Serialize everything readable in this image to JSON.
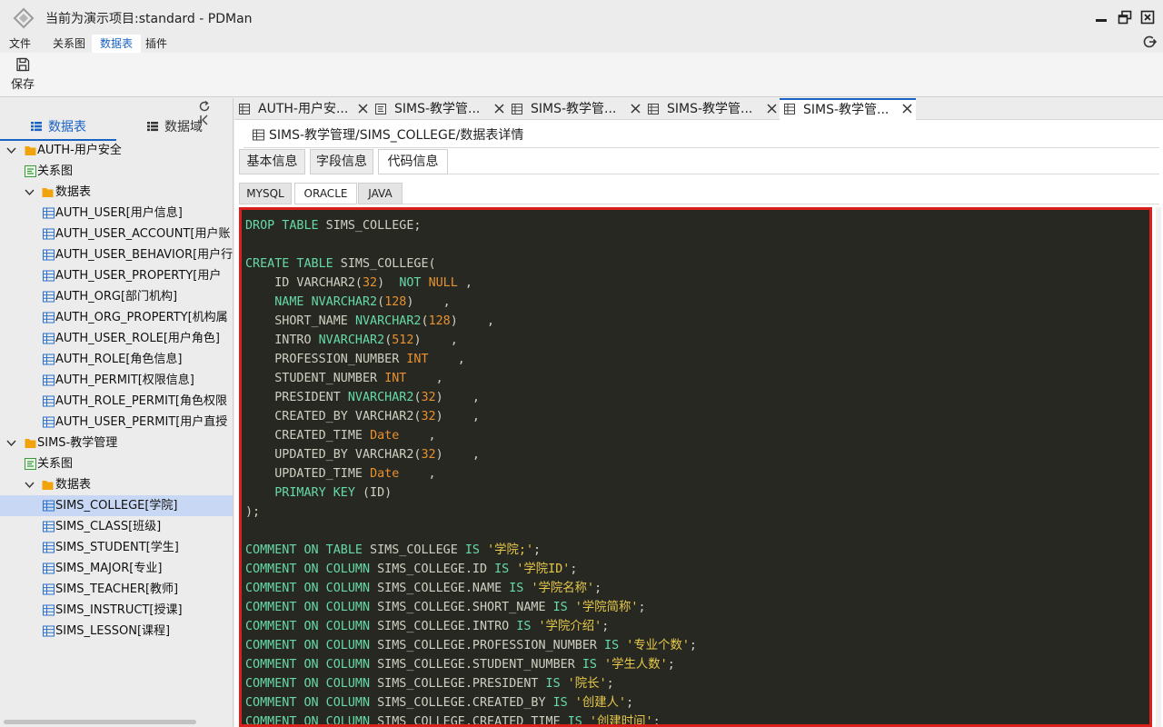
{
  "window": {
    "title": "当前为演示项目:standard - PDMan"
  },
  "menu": {
    "items": [
      {
        "label": "文件",
        "active": false
      },
      {
        "label": "关系图",
        "active": false
      },
      {
        "label": "数据表",
        "active": true
      },
      {
        "label": "插件",
        "active": false
      }
    ]
  },
  "toolbar": {
    "save_label": "保存"
  },
  "sidebar": {
    "tabs": [
      {
        "label": "数据表",
        "active": true
      },
      {
        "label": "数据域",
        "active": false
      }
    ],
    "tree": [
      {
        "kind": "module",
        "label": "AUTH-用户安全",
        "indent": 0,
        "expanded": true
      },
      {
        "kind": "diagram",
        "label": "关系图",
        "indent": 1
      },
      {
        "kind": "folder",
        "label": "数据表",
        "indent": 1,
        "expanded": true
      },
      {
        "kind": "table",
        "label": "AUTH_USER[用户信息]",
        "indent": 2
      },
      {
        "kind": "table",
        "label": "AUTH_USER_ACCOUNT[用户账",
        "indent": 2
      },
      {
        "kind": "table",
        "label": "AUTH_USER_BEHAVIOR[用户行",
        "indent": 2
      },
      {
        "kind": "table",
        "label": "AUTH_USER_PROPERTY[用户",
        "indent": 2
      },
      {
        "kind": "table",
        "label": "AUTH_ORG[部门机构]",
        "indent": 2
      },
      {
        "kind": "table",
        "label": "AUTH_ORG_PROPERTY[机构属",
        "indent": 2
      },
      {
        "kind": "table",
        "label": "AUTH_USER_ROLE[用户角色]",
        "indent": 2
      },
      {
        "kind": "table",
        "label": "AUTH_ROLE[角色信息]",
        "indent": 2
      },
      {
        "kind": "table",
        "label": "AUTH_PERMIT[权限信息]",
        "indent": 2
      },
      {
        "kind": "table",
        "label": "AUTH_ROLE_PERMIT[角色权限",
        "indent": 2
      },
      {
        "kind": "table",
        "label": "AUTH_USER_PERMIT[用户直授",
        "indent": 2
      },
      {
        "kind": "module",
        "label": "SIMS-教学管理",
        "indent": 0,
        "expanded": true
      },
      {
        "kind": "diagram",
        "label": "关系图",
        "indent": 1
      },
      {
        "kind": "folder",
        "label": "数据表",
        "indent": 1,
        "expanded": true
      },
      {
        "kind": "table",
        "label": "SIMS_COLLEGE[学院]",
        "indent": 2,
        "selected": true
      },
      {
        "kind": "table",
        "label": "SIMS_CLASS[班级]",
        "indent": 2
      },
      {
        "kind": "table",
        "label": "SIMS_STUDENT[学生]",
        "indent": 2
      },
      {
        "kind": "table",
        "label": "SIMS_MAJOR[专业]",
        "indent": 2
      },
      {
        "kind": "table",
        "label": "SIMS_TEACHER[教师]",
        "indent": 2
      },
      {
        "kind": "table",
        "label": "SIMS_INSTRUCT[授课]",
        "indent": 2
      },
      {
        "kind": "table",
        "label": "SIMS_LESSON[课程]",
        "indent": 2
      }
    ]
  },
  "doc_tabs": [
    {
      "icon": "table-icon",
      "label": "AUTH-用户安...",
      "active": false
    },
    {
      "icon": "diagram-icon",
      "label": "SIMS-教学管...",
      "active": false
    },
    {
      "icon": "table-icon",
      "label": "SIMS-教学管...",
      "active": false
    },
    {
      "icon": "table-icon",
      "label": "SIMS-教学管...",
      "active": false
    },
    {
      "icon": "table-icon",
      "label": "SIMS-教学管...",
      "active": true
    }
  ],
  "content": {
    "breadcrumb": "SIMS-教学管理/SIMS_COLLEGE/数据表详情",
    "sub_tabs": [
      {
        "label": "基本信息",
        "active": false
      },
      {
        "label": "字段信息",
        "active": false
      },
      {
        "label": "代码信息",
        "active": true
      }
    ],
    "db_tabs": [
      {
        "label": "MYSQL",
        "active": false
      },
      {
        "label": "ORACLE",
        "active": true
      },
      {
        "label": "JAVA",
        "active": false
      }
    ],
    "code_lines": [
      [
        [
          "kw",
          "DROP TABLE"
        ],
        [
          "tx",
          " SIMS_COLLEGE;"
        ]
      ],
      [],
      [
        [
          "kw",
          "CREATE TABLE"
        ],
        [
          "tx",
          " SIMS_COLLEGE("
        ]
      ],
      [
        [
          "tx",
          "    ID VARCHAR2("
        ],
        [
          "nm",
          "32"
        ],
        [
          "tx",
          ")  "
        ],
        [
          "kw",
          "NOT"
        ],
        [
          "tx",
          " "
        ],
        [
          "nm",
          "NULL"
        ],
        [
          "tx",
          " ,"
        ]
      ],
      [
        [
          "tx",
          "    "
        ],
        [
          "kw",
          "NAME"
        ],
        [
          "tx",
          " "
        ],
        [
          "ty",
          "NVARCHAR2"
        ],
        [
          "tx",
          "("
        ],
        [
          "nm",
          "128"
        ],
        [
          "tx",
          ")    ,"
        ]
      ],
      [
        [
          "tx",
          "    SHORT_NAME "
        ],
        [
          "ty",
          "NVARCHAR2"
        ],
        [
          "tx",
          "("
        ],
        [
          "nm",
          "128"
        ],
        [
          "tx",
          ")    ,"
        ]
      ],
      [
        [
          "tx",
          "    INTRO "
        ],
        [
          "ty",
          "NVARCHAR2"
        ],
        [
          "tx",
          "("
        ],
        [
          "nm",
          "512"
        ],
        [
          "tx",
          ")    ,"
        ]
      ],
      [
        [
          "tx",
          "    PROFESSION_NUMBER "
        ],
        [
          "nm",
          "INT"
        ],
        [
          "tx",
          "    ,"
        ]
      ],
      [
        [
          "tx",
          "    STUDENT_NUMBER "
        ],
        [
          "nm",
          "INT"
        ],
        [
          "tx",
          "    ,"
        ]
      ],
      [
        [
          "tx",
          "    PRESIDENT "
        ],
        [
          "ty",
          "NVARCHAR2"
        ],
        [
          "tx",
          "("
        ],
        [
          "nm",
          "32"
        ],
        [
          "tx",
          ")    ,"
        ]
      ],
      [
        [
          "tx",
          "    CREATED_BY VARCHAR2("
        ],
        [
          "nm",
          "32"
        ],
        [
          "tx",
          ")    ,"
        ]
      ],
      [
        [
          "tx",
          "    CREATED_TIME "
        ],
        [
          "dt",
          "Date"
        ],
        [
          "tx",
          "    ,"
        ]
      ],
      [
        [
          "tx",
          "    UPDATED_BY VARCHAR2("
        ],
        [
          "nm",
          "32"
        ],
        [
          "tx",
          ")    ,"
        ]
      ],
      [
        [
          "tx",
          "    UPDATED_TIME "
        ],
        [
          "dt",
          "Date"
        ],
        [
          "tx",
          "    ,"
        ]
      ],
      [
        [
          "tx",
          "    "
        ],
        [
          "kw",
          "PRIMARY KEY"
        ],
        [
          "tx",
          " (ID)"
        ]
      ],
      [
        [
          "tx",
          ");"
        ]
      ],
      [],
      [
        [
          "kw",
          "COMMENT ON TABLE"
        ],
        [
          "tx",
          " SIMS_COLLEGE "
        ],
        [
          "kw",
          "IS"
        ],
        [
          "tx",
          " "
        ],
        [
          "st",
          "'学院;'"
        ],
        [
          "tx",
          ";"
        ]
      ],
      [
        [
          "kw",
          "COMMENT ON COLUMN"
        ],
        [
          "tx",
          " SIMS_COLLEGE.ID "
        ],
        [
          "kw",
          "IS"
        ],
        [
          "tx",
          " "
        ],
        [
          "st",
          "'学院ID'"
        ],
        [
          "tx",
          ";"
        ]
      ],
      [
        [
          "kw",
          "COMMENT ON COLUMN"
        ],
        [
          "tx",
          " SIMS_COLLEGE.NAME "
        ],
        [
          "kw",
          "IS"
        ],
        [
          "tx",
          " "
        ],
        [
          "st",
          "'学院名称'"
        ],
        [
          "tx",
          ";"
        ]
      ],
      [
        [
          "kw",
          "COMMENT ON COLUMN"
        ],
        [
          "tx",
          " SIMS_COLLEGE.SHORT_NAME "
        ],
        [
          "kw",
          "IS"
        ],
        [
          "tx",
          " "
        ],
        [
          "st",
          "'学院简称'"
        ],
        [
          "tx",
          ";"
        ]
      ],
      [
        [
          "kw",
          "COMMENT ON COLUMN"
        ],
        [
          "tx",
          " SIMS_COLLEGE.INTRO "
        ],
        [
          "kw",
          "IS"
        ],
        [
          "tx",
          " "
        ],
        [
          "st",
          "'学院介绍'"
        ],
        [
          "tx",
          ";"
        ]
      ],
      [
        [
          "kw",
          "COMMENT ON COLUMN"
        ],
        [
          "tx",
          " SIMS_COLLEGE.PROFESSION_NUMBER "
        ],
        [
          "kw",
          "IS"
        ],
        [
          "tx",
          " "
        ],
        [
          "st",
          "'专业个数'"
        ],
        [
          "tx",
          ";"
        ]
      ],
      [
        [
          "kw",
          "COMMENT ON COLUMN"
        ],
        [
          "tx",
          " SIMS_COLLEGE.STUDENT_NUMBER "
        ],
        [
          "kw",
          "IS"
        ],
        [
          "tx",
          " "
        ],
        [
          "st",
          "'学生人数'"
        ],
        [
          "tx",
          ";"
        ]
      ],
      [
        [
          "kw",
          "COMMENT ON COLUMN"
        ],
        [
          "tx",
          " SIMS_COLLEGE.PRESIDENT "
        ],
        [
          "kw",
          "IS"
        ],
        [
          "tx",
          " "
        ],
        [
          "st",
          "'院长'"
        ],
        [
          "tx",
          ";"
        ]
      ],
      [
        [
          "kw",
          "COMMENT ON COLUMN"
        ],
        [
          "tx",
          " SIMS_COLLEGE.CREATED_BY "
        ],
        [
          "kw",
          "IS"
        ],
        [
          "tx",
          " "
        ],
        [
          "st",
          "'创建人'"
        ],
        [
          "tx",
          ";"
        ]
      ],
      [
        [
          "kw",
          "COMMENT ON COLUMN"
        ],
        [
          "tx",
          " SIMS_COLLEGE.CREATED_TIME "
        ],
        [
          "kw",
          "IS"
        ],
        [
          "tx",
          " "
        ],
        [
          "st",
          "'创建时间'"
        ],
        [
          "tx",
          ";"
        ]
      ]
    ]
  },
  "colors": {
    "accent": "#1a62c4",
    "selection": "#c8d8f4",
    "code_bg": "#272822",
    "highlight_border": "#d9201c",
    "folder": "#f0a30a",
    "table_icon": "#2a6fc9",
    "diagram_icon": "#3a9a3a"
  }
}
